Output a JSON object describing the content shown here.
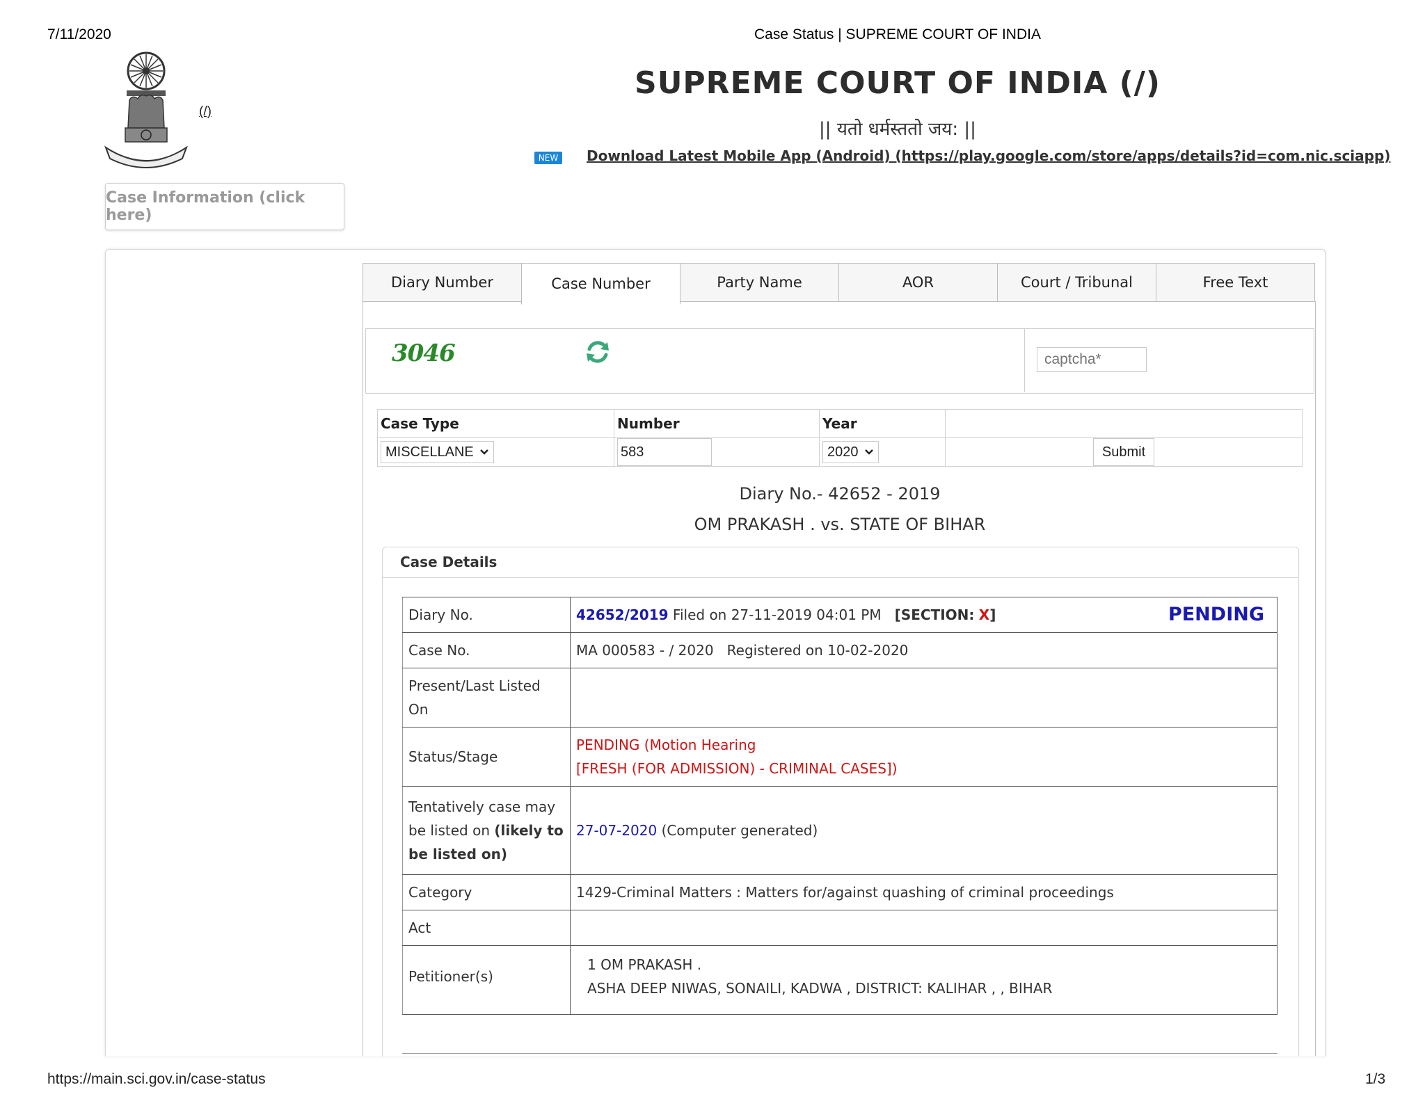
{
  "print_header": {
    "date": "7/11/2020",
    "page_title": "Case Status | SUPREME COURT OF INDIA",
    "url": "https://main.sci.gov.in/case-status",
    "page": "1/3"
  },
  "header": {
    "home_link": "(/)",
    "title": "SUPREME COURT OF INDIA (/)",
    "motto": "|| यतो धर्मस्ततो जय: ||",
    "new_badge": "NEW",
    "app_link": "Download Latest Mobile App (Android) (https://play.google.com/store/apps/details?id=com.nic.sciapp)"
  },
  "case_info_button": "Case Information (click here)",
  "tabs": [
    {
      "label": "Diary Number"
    },
    {
      "label": "Case Number"
    },
    {
      "label": "Party Name"
    },
    {
      "label": "AOR"
    },
    {
      "label": "Court / Tribunal"
    },
    {
      "label": "Free Text"
    }
  ],
  "captcha": {
    "code": "3046",
    "placeholder": "captcha*"
  },
  "search_form": {
    "headers": {
      "case_type": "Case Type",
      "number": "Number",
      "year": "Year"
    },
    "case_type_value": "MISCELLANE",
    "number_value": "583",
    "year_value": "2020",
    "submit_label": "Submit"
  },
  "result": {
    "diary_heading": "Diary No.- 42652 - 2019",
    "parties_heading": "OM PRAKASH . vs. STATE OF BIHAR",
    "details_title": "Case Details"
  },
  "details": {
    "diary": {
      "label": "Diary No.",
      "number": "42652/2019",
      "filed": "Filed on 27-11-2019 04:01 PM",
      "section_label": "[SECTION:",
      "section_value": "X",
      "section_close": "]",
      "status": "PENDING"
    },
    "case_no": {
      "label": "Case No.",
      "value": "MA 000583 - / 2020   Registered on 10-02-2020"
    },
    "listed": {
      "label": "Present/Last Listed On",
      "value": ""
    },
    "status": {
      "label": "Status/Stage",
      "line1": "PENDING (Motion Hearing",
      "line2": "[FRESH (FOR ADMISSION) - CRIMINAL CASES])"
    },
    "tentative": {
      "label_pre": "Tentatively case may be listed on ",
      "label_bold": "(likely to be listed on)",
      "date": "27-07-2020",
      "note": "(Computer generated)"
    },
    "category": {
      "label": "Category",
      "value": "1429-Criminal Matters : Matters for/against quashing of criminal proceedings"
    },
    "act": {
      "label": "Act",
      "value": ""
    },
    "petitioner": {
      "label": "Petitioner(s)",
      "line1": "1 OM PRAKASH .",
      "line2": "ASHA DEEP NIWAS, SONAILI, KADWA , DISTRICT: KALIHAR , , BIHAR"
    }
  },
  "colors": {
    "link_blue": "#1a1ab0",
    "status_red": "#d11414",
    "badge_blue": "#1a86d8"
  }
}
